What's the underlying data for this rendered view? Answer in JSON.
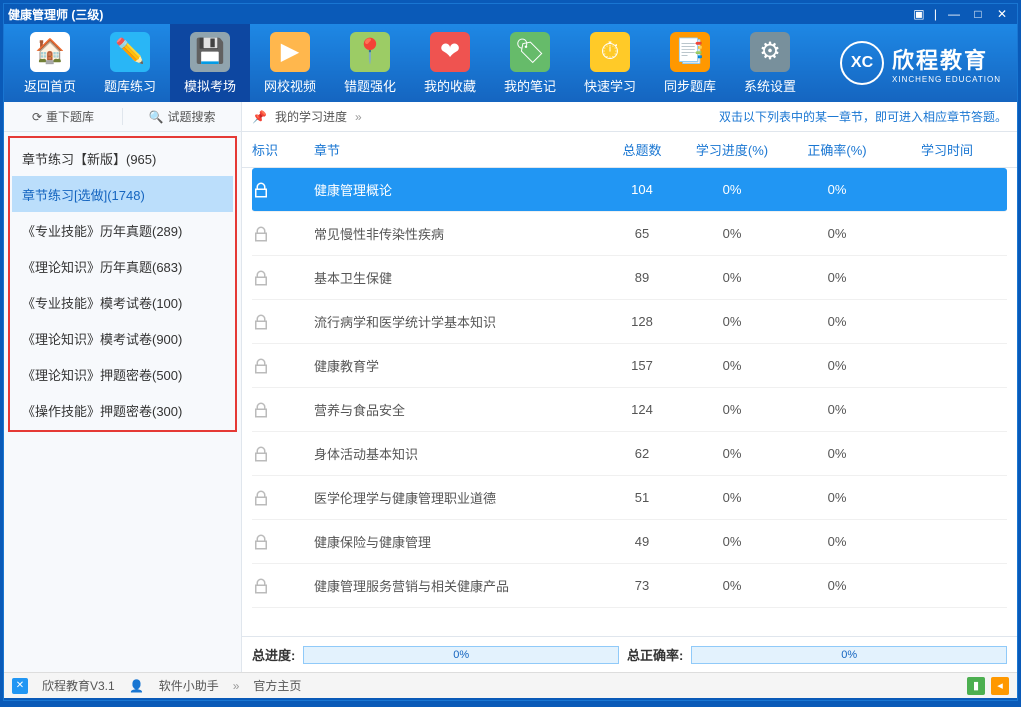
{
  "title": "健康管理师 (三级)",
  "toolbar": [
    {
      "label": "返回首页"
    },
    {
      "label": "题库练习"
    },
    {
      "label": "模拟考场"
    },
    {
      "label": "网校视频"
    },
    {
      "label": "错题强化"
    },
    {
      "label": "我的收藏"
    },
    {
      "label": "我的笔记"
    },
    {
      "label": "快速学习"
    },
    {
      "label": "同步题库"
    },
    {
      "label": "系统设置"
    }
  ],
  "brand": {
    "name": "欣程教育",
    "sub": "XINCHENG EDUCATION",
    "badge": "XC"
  },
  "sidebar": {
    "redownload": "重下题库",
    "search": "试题搜索",
    "items": [
      "章节练习【新版】(965)",
      "章节练习[选做](1748)",
      "《专业技能》历年真题(289)",
      "《理论知识》历年真题(683)",
      "《专业技能》模考试卷(100)",
      "《理论知识》模考试卷(900)",
      "《理论知识》押题密卷(500)",
      "《操作技能》押题密卷(300)"
    ]
  },
  "main": {
    "progress_label": "我的学习进度",
    "tip": "双击以下列表中的某一章节，即可进入相应章节答题。",
    "columns": {
      "mark": "标识",
      "chapter": "章节",
      "total": "总题数",
      "progress": "学习进度(%)",
      "accuracy": "正确率(%)",
      "time": "学习时间"
    },
    "rows": [
      {
        "chapter": "健康管理概论",
        "total": "104",
        "progress": "0%",
        "accuracy": "0%"
      },
      {
        "chapter": "常见慢性非传染性疾病",
        "total": "65",
        "progress": "0%",
        "accuracy": "0%"
      },
      {
        "chapter": "基本卫生保健",
        "total": "89",
        "progress": "0%",
        "accuracy": "0%"
      },
      {
        "chapter": "流行病学和医学统计学基本知识",
        "total": "128",
        "progress": "0%",
        "accuracy": "0%"
      },
      {
        "chapter": "健康教育学",
        "total": "157",
        "progress": "0%",
        "accuracy": "0%"
      },
      {
        "chapter": "营养与食品安全",
        "total": "124",
        "progress": "0%",
        "accuracy": "0%"
      },
      {
        "chapter": "身体活动基本知识",
        "total": "62",
        "progress": "0%",
        "accuracy": "0%"
      },
      {
        "chapter": "医学伦理学与健康管理职业道德",
        "total": "51",
        "progress": "0%",
        "accuracy": "0%"
      },
      {
        "chapter": "健康保险与健康管理",
        "total": "49",
        "progress": "0%",
        "accuracy": "0%"
      },
      {
        "chapter": "健康管理服务营销与相关健康产品",
        "total": "73",
        "progress": "0%",
        "accuracy": "0%"
      }
    ],
    "total_progress_label": "总进度:",
    "total_progress": "0%",
    "total_accuracy_label": "总正确率:",
    "total_accuracy": "0%"
  },
  "status": {
    "app": "欣程教育V3.1",
    "helper": "软件小助手",
    "home": "官方主页"
  }
}
